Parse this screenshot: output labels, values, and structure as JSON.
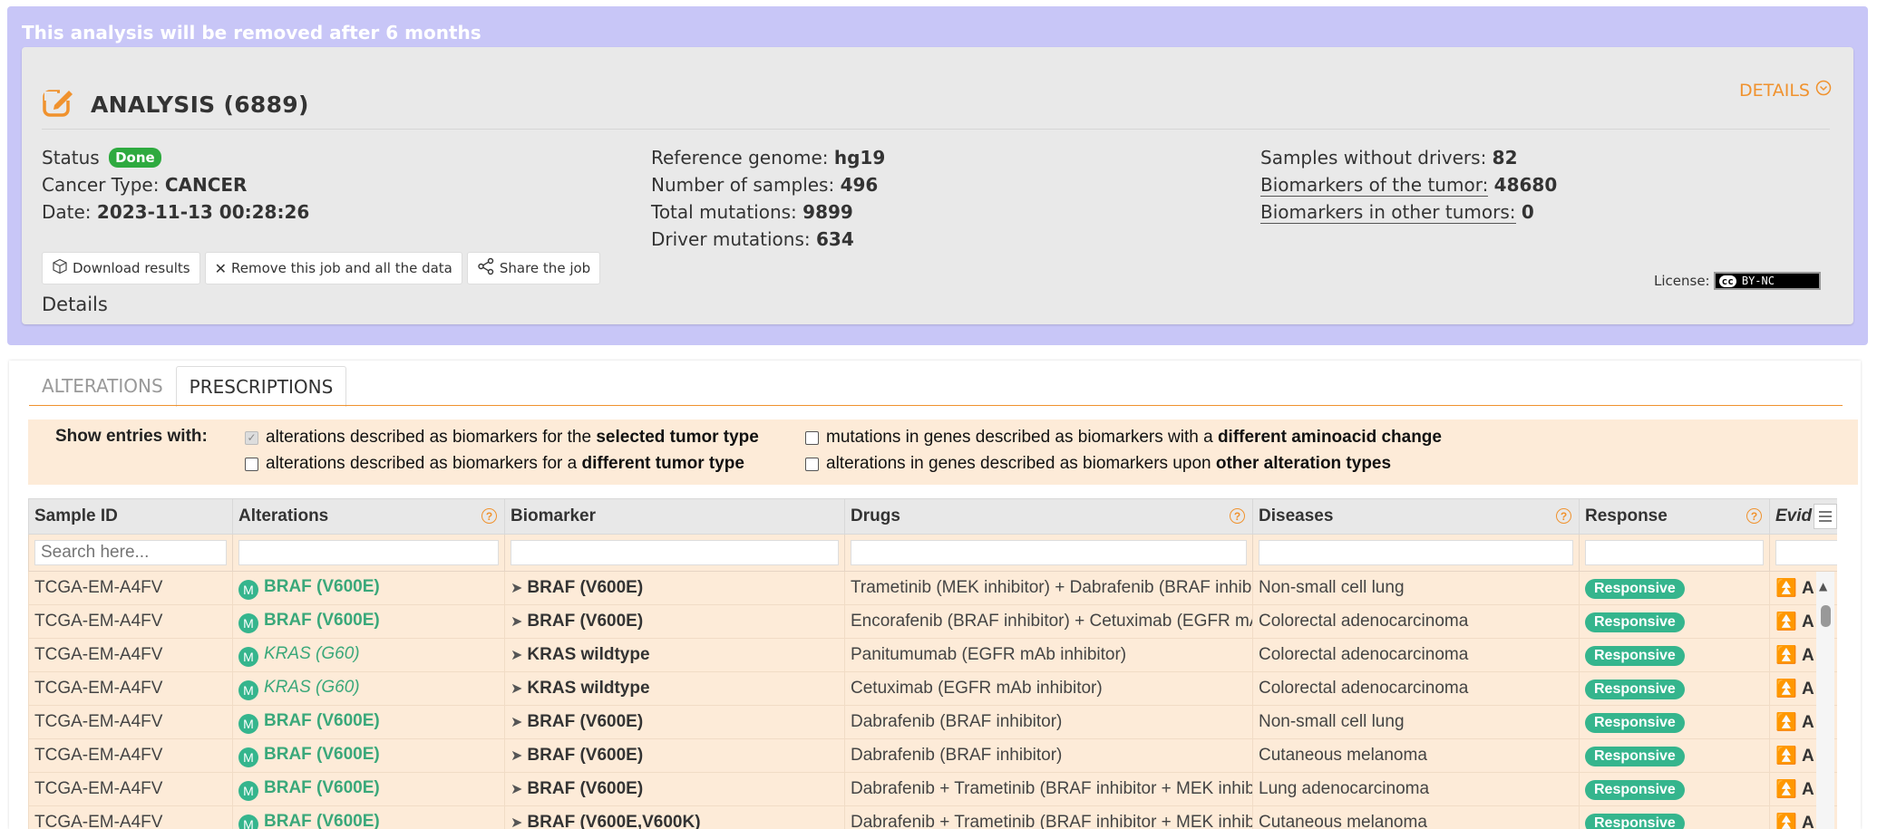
{
  "banner": {
    "text": "This analysis will be removed after 6 months"
  },
  "analysis": {
    "title": "ANALYSIS (6889)",
    "details_toggle": "DETAILS",
    "status_label": "Status",
    "status_value": "Done",
    "cancer_type_label": "Cancer Type:",
    "cancer_type_value": "CANCER",
    "date_label": "Date:",
    "date_value": "2023-11-13 00:28:26",
    "ref_genome_label": "Reference genome:",
    "ref_genome_value": "hg19",
    "num_samples_label": "Number of samples:",
    "num_samples_value": "496",
    "total_mutations_label": "Total mutations:",
    "total_mutations_value": "9899",
    "driver_mutations_label": "Driver mutations:",
    "driver_mutations_value": "634",
    "no_drivers_label": "Samples without drivers:",
    "no_drivers_value": "82",
    "biomarkers_tumor_label": "Biomarkers of the tumor:",
    "biomarkers_tumor_value": "48680",
    "biomarkers_other_label": "Biomarkers in other tumors:",
    "biomarkers_other_value": "0",
    "buttons": {
      "download": "Download results",
      "remove": "Remove this job and all the data",
      "share": "Share the job"
    },
    "details_label": "Details",
    "license_label": "License:",
    "license_badge": "BY-NC"
  },
  "tabs": [
    {
      "label": "ALTERATIONS",
      "active": false
    },
    {
      "label": "PRESCRIPTIONS",
      "active": true
    }
  ],
  "filters": {
    "label": "Show entries with:",
    "opt1_pre": "alterations described as biomarkers for the ",
    "opt1_bold": "selected tumor type",
    "opt2_pre": "alterations described as biomarkers for a ",
    "opt2_bold": "different tumor type",
    "opt3_pre": "mutations in genes described as biomarkers with a ",
    "opt3_bold": "different aminoacid change",
    "opt4_pre": "alterations in genes described as biomarkers upon ",
    "opt4_bold": "other alteration types"
  },
  "table": {
    "headers": {
      "sample": "Sample ID",
      "alterations": "Alterations",
      "biomarker": "Biomarker",
      "drugs": "Drugs",
      "diseases": "Diseases",
      "response": "Response",
      "evidence": "Evid"
    },
    "search_placeholder": "Search here...",
    "rows": [
      {
        "sample": "TCGA-EM-A4FV",
        "alteration": "BRAF (V600E)",
        "biomarker": "BRAF (V600E)",
        "drugs": "Trametinib (MEK inhibitor) + Dabrafenib (BRAF inhibitor)",
        "disease": "Non-small cell lung",
        "response": "Responsive",
        "evidence": "A"
      },
      {
        "sample": "TCGA-EM-A4FV",
        "alteration": "BRAF (V600E)",
        "biomarker": "BRAF (V600E)",
        "drugs": "Encorafenib (BRAF inhibitor) + Cetuximab (EGFR mAb inhibitor)",
        "disease": "Colorectal adenocarcinoma",
        "response": "Responsive",
        "evidence": "A"
      },
      {
        "sample": "TCGA-EM-A4FV",
        "alteration": "KRAS (G60)",
        "biomarker": "KRAS wildtype",
        "drugs": "Panitumumab (EGFR mAb inhibitor)",
        "disease": "Colorectal adenocarcinoma",
        "response": "Responsive",
        "evidence": "A"
      },
      {
        "sample": "TCGA-EM-A4FV",
        "alteration": "KRAS (G60)",
        "biomarker": "KRAS wildtype",
        "drugs": "Cetuximab (EGFR mAb inhibitor)",
        "disease": "Colorectal adenocarcinoma",
        "response": "Responsive",
        "evidence": "A"
      },
      {
        "sample": "TCGA-EM-A4FV",
        "alteration": "BRAF (V600E)",
        "biomarker": "BRAF (V600E)",
        "drugs": "Dabrafenib (BRAF inhibitor)",
        "disease": "Non-small cell lung",
        "response": "Responsive",
        "evidence": "A"
      },
      {
        "sample": "TCGA-EM-A4FV",
        "alteration": "BRAF (V600E)",
        "biomarker": "BRAF (V600E)",
        "drugs": "Dabrafenib (BRAF inhibitor)",
        "disease": "Cutaneous melanoma",
        "response": "Responsive",
        "evidence": "A"
      },
      {
        "sample": "TCGA-EM-A4FV",
        "alteration": "BRAF (V600E)",
        "biomarker": "BRAF (V600E)",
        "drugs": "Dabrafenib + Trametinib (BRAF inhibitor + MEK inhibitor)",
        "disease": "Lung adenocarcinoma",
        "response": "Responsive",
        "evidence": "A"
      },
      {
        "sample": "TCGA-EM-A4FV",
        "alteration": "BRAF (V600E)",
        "biomarker": "BRAF (V600E,V600K)",
        "drugs": "Dabrafenib + Trametinib (BRAF inhibitor + MEK inhibitor)",
        "disease": "Cutaneous melanoma",
        "response": "Responsive",
        "evidence": "A"
      }
    ]
  },
  "colors": {
    "banner_bg": "#c8c6f7",
    "accent_orange": "#f0922e",
    "status_green": "#2eaa3f",
    "alteration_green": "#35b58d",
    "filter_bg": "#fdebd8"
  },
  "icons": {
    "title": "edit-icon",
    "details": "chevron-circle-down-icon",
    "download": "package-icon",
    "remove": "close-icon",
    "share": "share-icon",
    "mutation": "m-badge-icon",
    "biomarker": "paper-plane-icon",
    "evidence": "double-chevron-up-icon",
    "help": "question-circle-icon",
    "column_menu": "hamburger-menu-icon"
  }
}
